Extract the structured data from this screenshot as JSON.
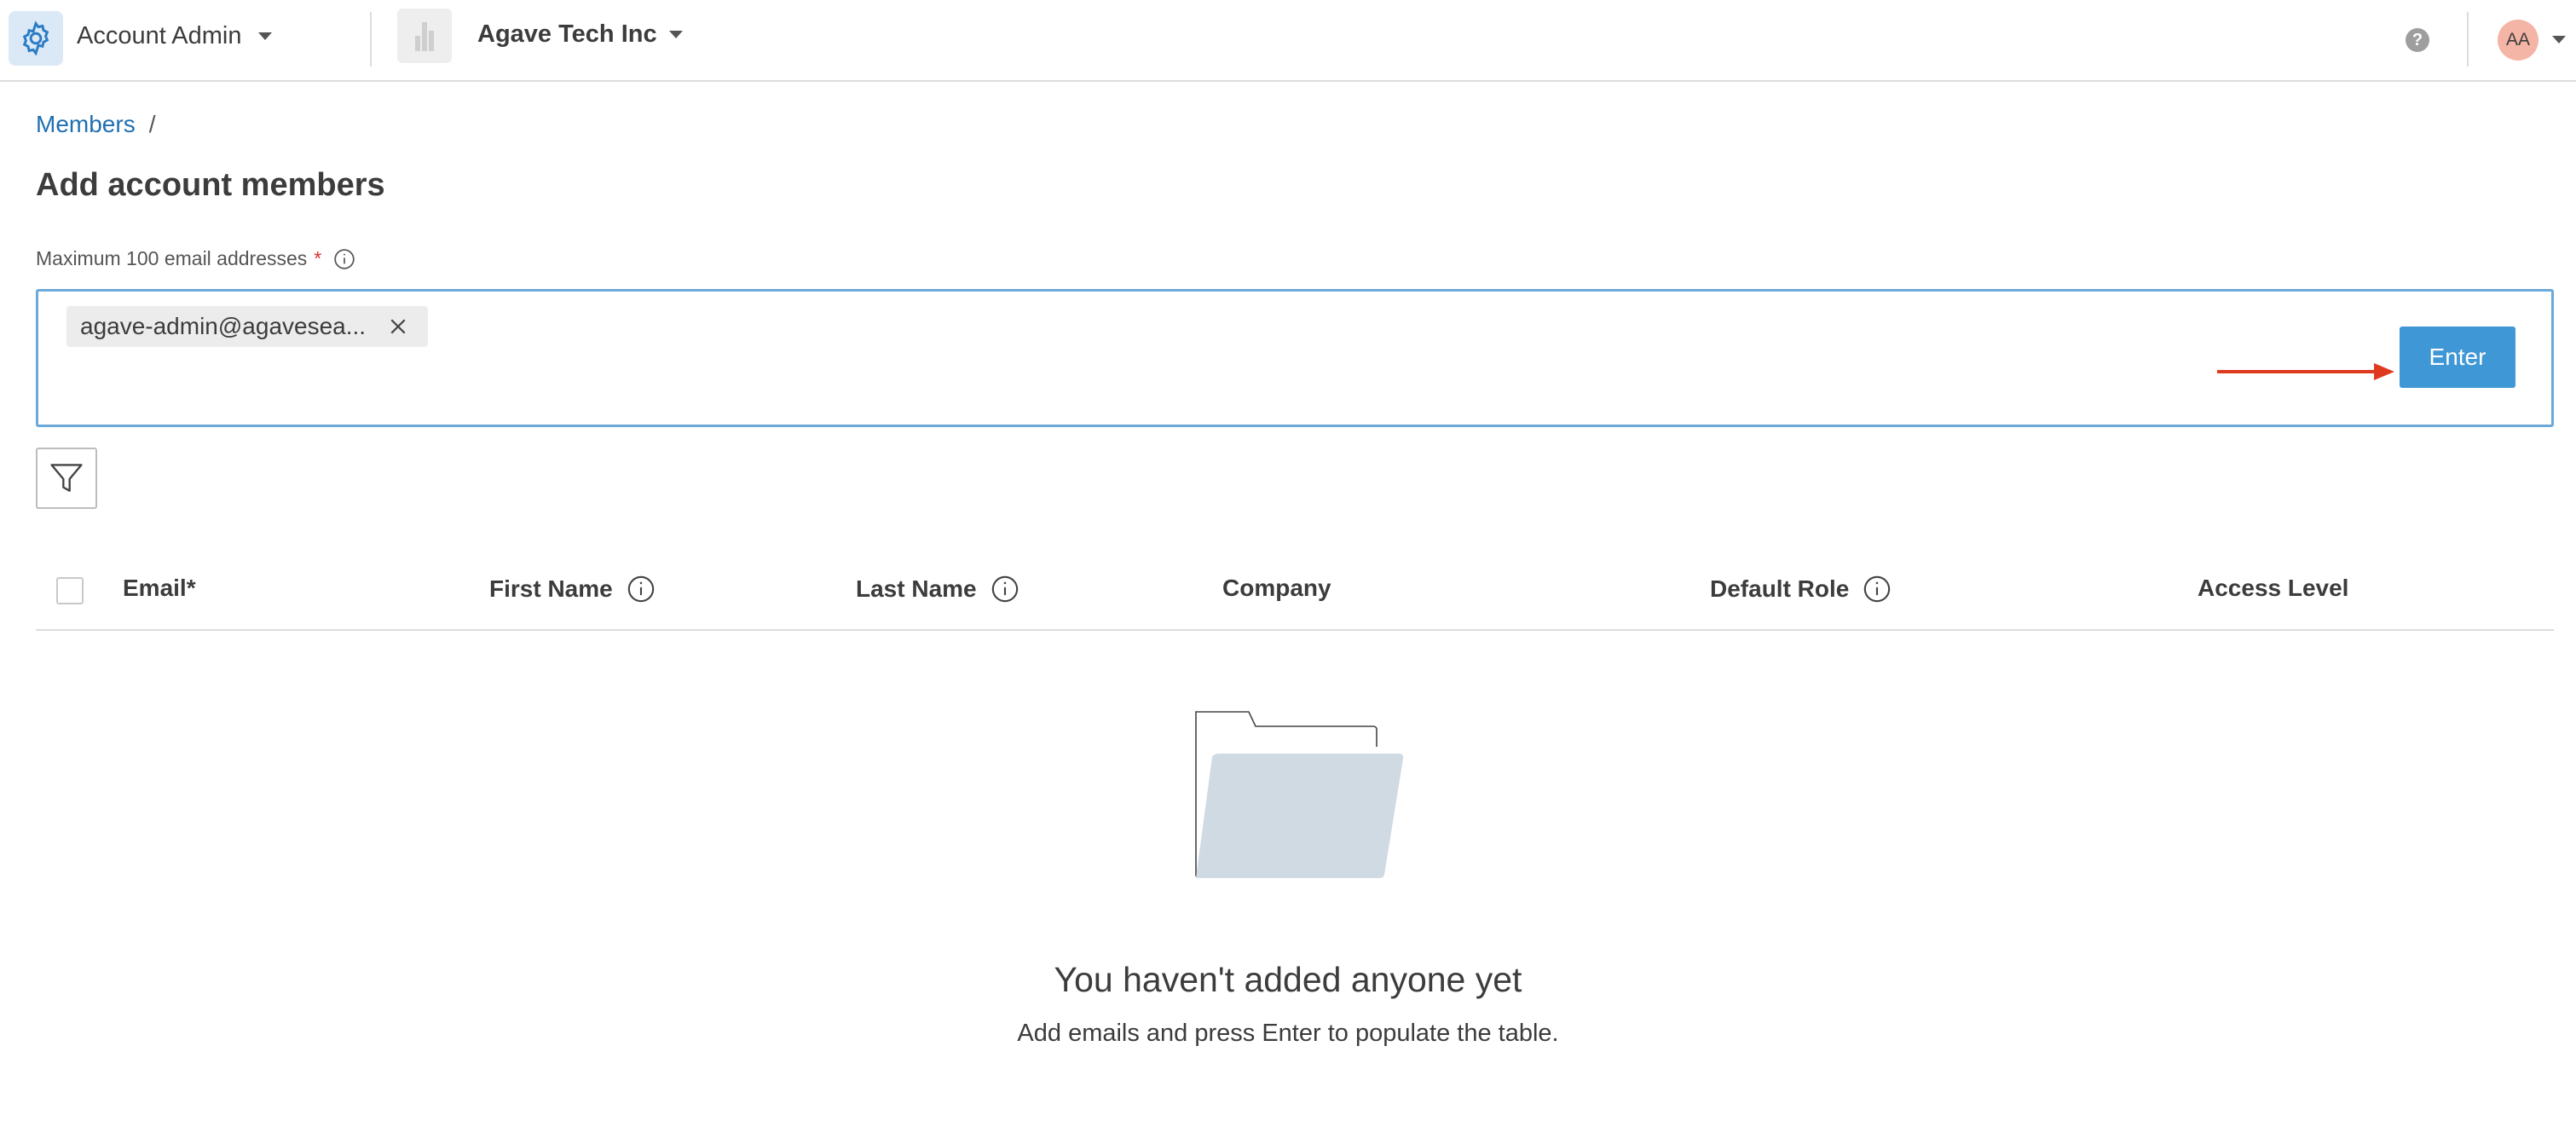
{
  "header": {
    "app_name": "Account Admin",
    "app_icon": "gear-icon",
    "company_name": "Agave Tech Inc",
    "company_logo": "building-icon",
    "help_icon": "question-circle-icon",
    "avatar_initials": "AA"
  },
  "breadcrumb": {
    "parent": "Members",
    "separator": "/"
  },
  "page": {
    "title": "Add account members"
  },
  "email_input": {
    "label": "Maximum 100 email addresses",
    "required_marker": "*",
    "chips": [
      {
        "text": "agave-admin@agavesea..."
      }
    ],
    "enter_label": "Enter"
  },
  "filter": {
    "icon": "filter-icon"
  },
  "table": {
    "columns": [
      {
        "label": "Email*",
        "info": false
      },
      {
        "label": "First Name",
        "info": true
      },
      {
        "label": "Last Name",
        "info": true
      },
      {
        "label": "Company",
        "info": false
      },
      {
        "label": "Default Role",
        "info": true
      },
      {
        "label": "Access Level",
        "info": false
      }
    ]
  },
  "empty_state": {
    "title": "You haven't added anyone yet",
    "subtitle": "Add emails and press Enter to populate the table."
  },
  "colors": {
    "accent": "#3f97d6",
    "link": "#1f6fb2",
    "annotation_arrow": "#e03a1e",
    "required": "#d9302f"
  }
}
